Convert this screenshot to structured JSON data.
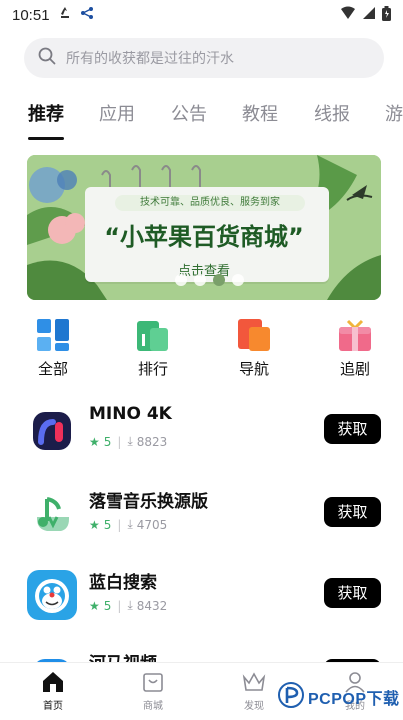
{
  "status_bar": {
    "time": "10:51"
  },
  "search": {
    "placeholder": "所有的收获都是过往的汗水"
  },
  "tabs": [
    {
      "label": "推荐",
      "active": true
    },
    {
      "label": "应用",
      "active": false
    },
    {
      "label": "公告",
      "active": false
    },
    {
      "label": "教程",
      "active": false
    },
    {
      "label": "线报",
      "active": false
    },
    {
      "label": "游",
      "active": false
    }
  ],
  "banner": {
    "subtitle": "技术可靠、品质优良、服务到家",
    "title": "“小苹果百货商城”",
    "cta": "点击查看",
    "slide_index": 3,
    "slide_count": 4
  },
  "categories": [
    {
      "label": "全部",
      "icon": "grid-icon",
      "color": "#2f8fe6"
    },
    {
      "label": "排行",
      "icon": "ranking-icon",
      "color": "#3cb877"
    },
    {
      "label": "导航",
      "icon": "navigation-icon",
      "color": "#f2573c"
    },
    {
      "label": "追剧",
      "icon": "gift-tv-icon",
      "color": "#f06a8a"
    }
  ],
  "apps": [
    {
      "name": "MINO 4K",
      "score": "5",
      "downloads": "8823",
      "button": "获取"
    },
    {
      "name": "落雪音乐换源版",
      "score": "5",
      "downloads": "4705",
      "button": "获取"
    },
    {
      "name": "蓝白搜索",
      "score": "5",
      "downloads": "8432",
      "button": "获取"
    },
    {
      "name": "河马视频",
      "score": "",
      "downloads": "",
      "button": "获取"
    }
  ],
  "bottom_nav": [
    {
      "label": "首页",
      "icon": "home-icon",
      "active": true
    },
    {
      "label": "商城",
      "icon": "shop-icon",
      "active": false
    },
    {
      "label": "发现",
      "icon": "crown-icon",
      "active": false
    },
    {
      "label": "我的",
      "icon": "user-icon",
      "active": false
    }
  ],
  "watermark": {
    "text": "PCPOP下载"
  },
  "colors": {
    "accent": "#000000",
    "banner_green": "#a8cf8f",
    "rating_green": "#3fb06a"
  }
}
